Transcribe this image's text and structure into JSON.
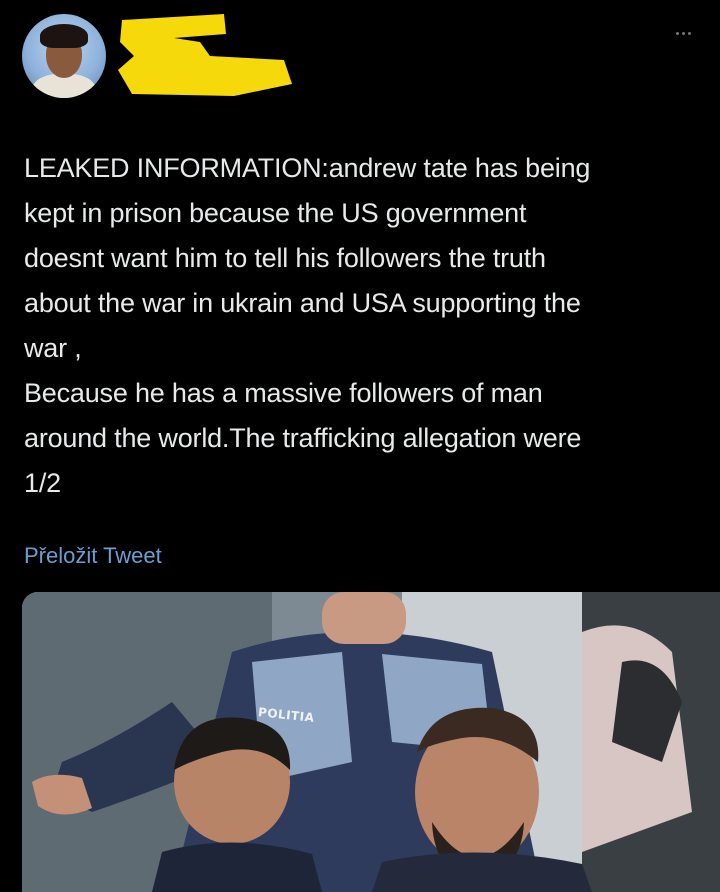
{
  "tweet": {
    "text_lines": [
      "LEAKED INFORMATION:andrew tate has being",
      "kept in prison because the US government",
      "doesnt want him to tell his followers the truth",
      "about the war in ukrain and USA  supporting the",
      "war ,",
      "Because he has a massive followers  of man",
      "around the world.The trafficking allegation were",
      "1/2"
    ],
    "translate_label": "Přeložit Tweet",
    "more_icon": "more-horizontal-icon"
  },
  "media": {
    "badge_text": "POLITIA"
  },
  "colors": {
    "background": "#000000",
    "text": "#e7e9ea",
    "link": "#6a9fd6",
    "redaction": "#f5d90a"
  }
}
